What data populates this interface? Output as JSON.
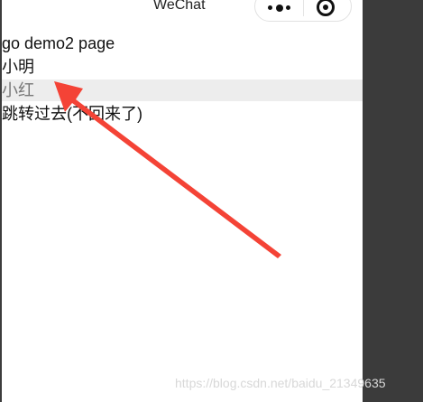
{
  "window": {
    "title": "WeChat"
  },
  "capsule": {
    "more_icon": "more-dots-icon",
    "close_icon": "close-target-icon"
  },
  "content": {
    "lines": [
      "go demo2 page",
      "小明",
      "小红",
      "跳转过去(不回来了)"
    ]
  },
  "watermark": "https://blog.csdn.net/baidu_21349635",
  "colors": {
    "highlight": "#ededed",
    "arrow": "#f44336",
    "right_panel": "#3b3b3b"
  }
}
